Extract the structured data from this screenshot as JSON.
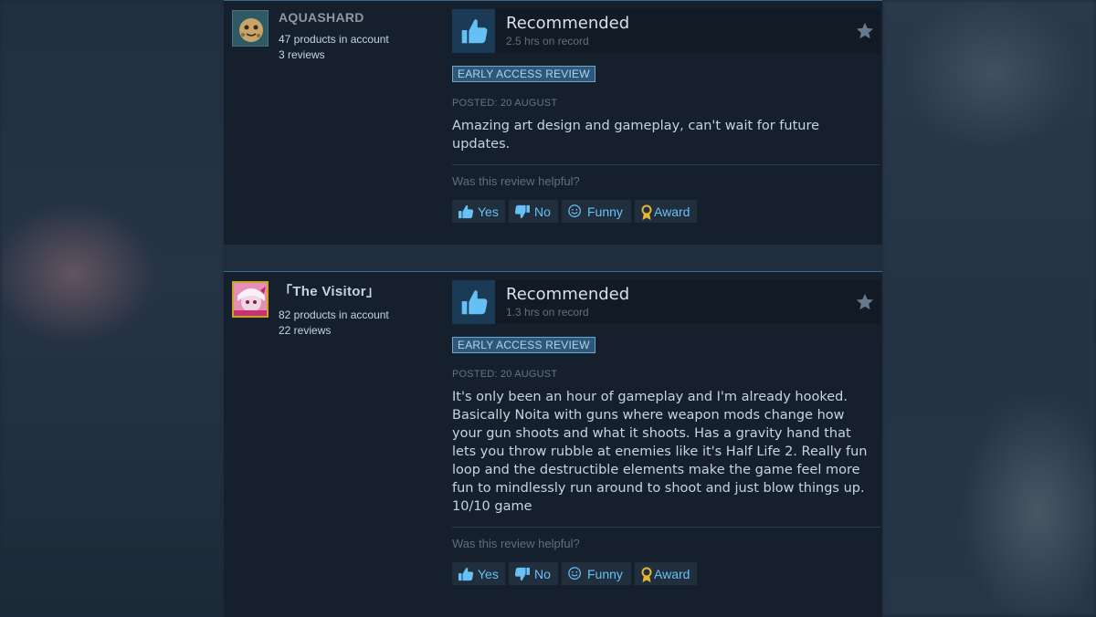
{
  "reviews": [
    {
      "author": {
        "name": "AQUASHARD",
        "products": "47 products in account",
        "reviews_count": "3 reviews"
      },
      "verdict": "Recommended",
      "hours": "2.5 hrs on record",
      "badge": "EARLY ACCESS REVIEW",
      "posted": "POSTED: 20 AUGUST",
      "text": "Amazing art design and gameplay, can't wait for future updates.",
      "helpful_prompt": "Was this review helpful?",
      "buttons": {
        "yes": "Yes",
        "no": "No",
        "funny": "Funny",
        "award": "Award"
      }
    },
    {
      "author": {
        "name": "「The Visitor」",
        "products": "82 products in account",
        "reviews_count": "22 reviews"
      },
      "verdict": "Recommended",
      "hours": "1.3 hrs on record",
      "badge": "EARLY ACCESS REVIEW",
      "posted": "POSTED: 20 AUGUST",
      "text": "It's only been an hour of gameplay and I'm already hooked. Basically Noita with guns where weapon mods change how your gun shoots and what it shoots. Has a gravity hand that lets you throw rubble at enemies like it's Half Life 2. Really fun loop and the destructible elements make the game feel more fun to mindlessly run around to shoot and just blow things up. 10/10 game",
      "helpful_prompt": "Was this review helpful?",
      "buttons": {
        "yes": "Yes",
        "no": "No",
        "funny": "Funny",
        "award": "Award"
      }
    }
  ],
  "icons": [
    "thumbs-up-icon",
    "thumbs-down-icon",
    "smiley-icon",
    "award-ribbon-icon",
    "star-icon"
  ],
  "colors": {
    "accent": "#67c1f5",
    "panel": "#16202d",
    "badge_bg": "#2f5878"
  }
}
